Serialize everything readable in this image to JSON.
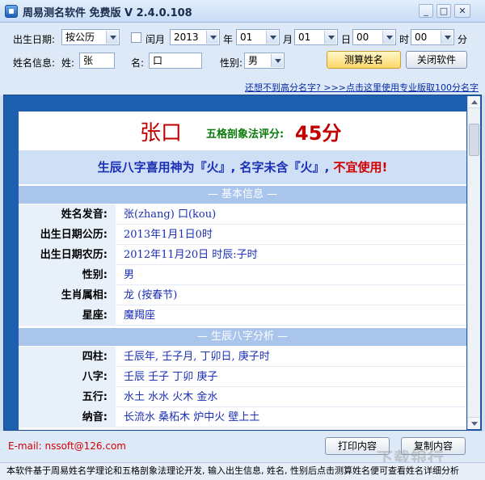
{
  "window": {
    "title": "周易测名软件 免费版  V 2.4.0.108",
    "minimize_label": "_",
    "maximize_label": "□",
    "close_label": "✕"
  },
  "form": {
    "birth_date_label": "出生日期:",
    "calendar_type": "按公历",
    "leap_month_label": "闰月",
    "year_value": "2013",
    "year_unit": "年",
    "month_value": "01",
    "month_unit": "月",
    "day_value": "01",
    "day_unit": "日",
    "hour_value": "00",
    "hour_unit": "时",
    "minute_value": "00",
    "minute_unit": "分",
    "name_info_label": "姓名信息:",
    "surname_label": "姓:",
    "surname_value": "张",
    "given_label": "名:",
    "given_value": "口",
    "gender_label": "性别:",
    "gender_value": "男",
    "calc_button": "测算姓名",
    "close_button": "关闭软件",
    "pro_link": "还想不到高分名字?  >>>点击这里使用专业版取100分名字"
  },
  "result": {
    "name": "张口",
    "score_label": "五格剖象法评分:",
    "score_value": "45分",
    "verdict_main": "生辰八字喜用神为『火』, 名字未含『火』,",
    "verdict_bad": "不宜使用!",
    "section_basic": "— 基本信息 —",
    "basic_rows": [
      {
        "k": "姓名发音:",
        "v": "张(zhang) 口(kou)"
      },
      {
        "k": "出生日期公历:",
        "v": "2013年1月1日0时"
      },
      {
        "k": "出生日期农历:",
        "v": "2012年11月20日 时辰:子时"
      },
      {
        "k": "性别:",
        "v": "男"
      },
      {
        "k": "生肖属相:",
        "v": "龙 (按春节)"
      },
      {
        "k": "星座:",
        "v": "魔羯座"
      }
    ],
    "section_bazi": "— 生辰八字分析 —",
    "bazi_rows": [
      {
        "k": "四柱:",
        "v": "壬辰年,  壬子月,  丁卯日,  庚子时"
      },
      {
        "k": "八字:",
        "v": "壬辰  壬子  丁卯  庚子"
      },
      {
        "k": "五行:",
        "v": "水土  水水  火木  金水"
      },
      {
        "k": "纳音:",
        "v": "长流水  桑柘木  炉中火  壁上土"
      }
    ]
  },
  "footer": {
    "email": "E-mail:  nssoft@126.com",
    "print_button": "打印内容",
    "copy_button": "复制内容",
    "status": "本软件基于周易姓名学理论和五格剖象法理论开发, 输入出生信息, 姓名, 性别后点击测算姓名便可查看姓名详细分析",
    "watermark": "下载银行"
  }
}
